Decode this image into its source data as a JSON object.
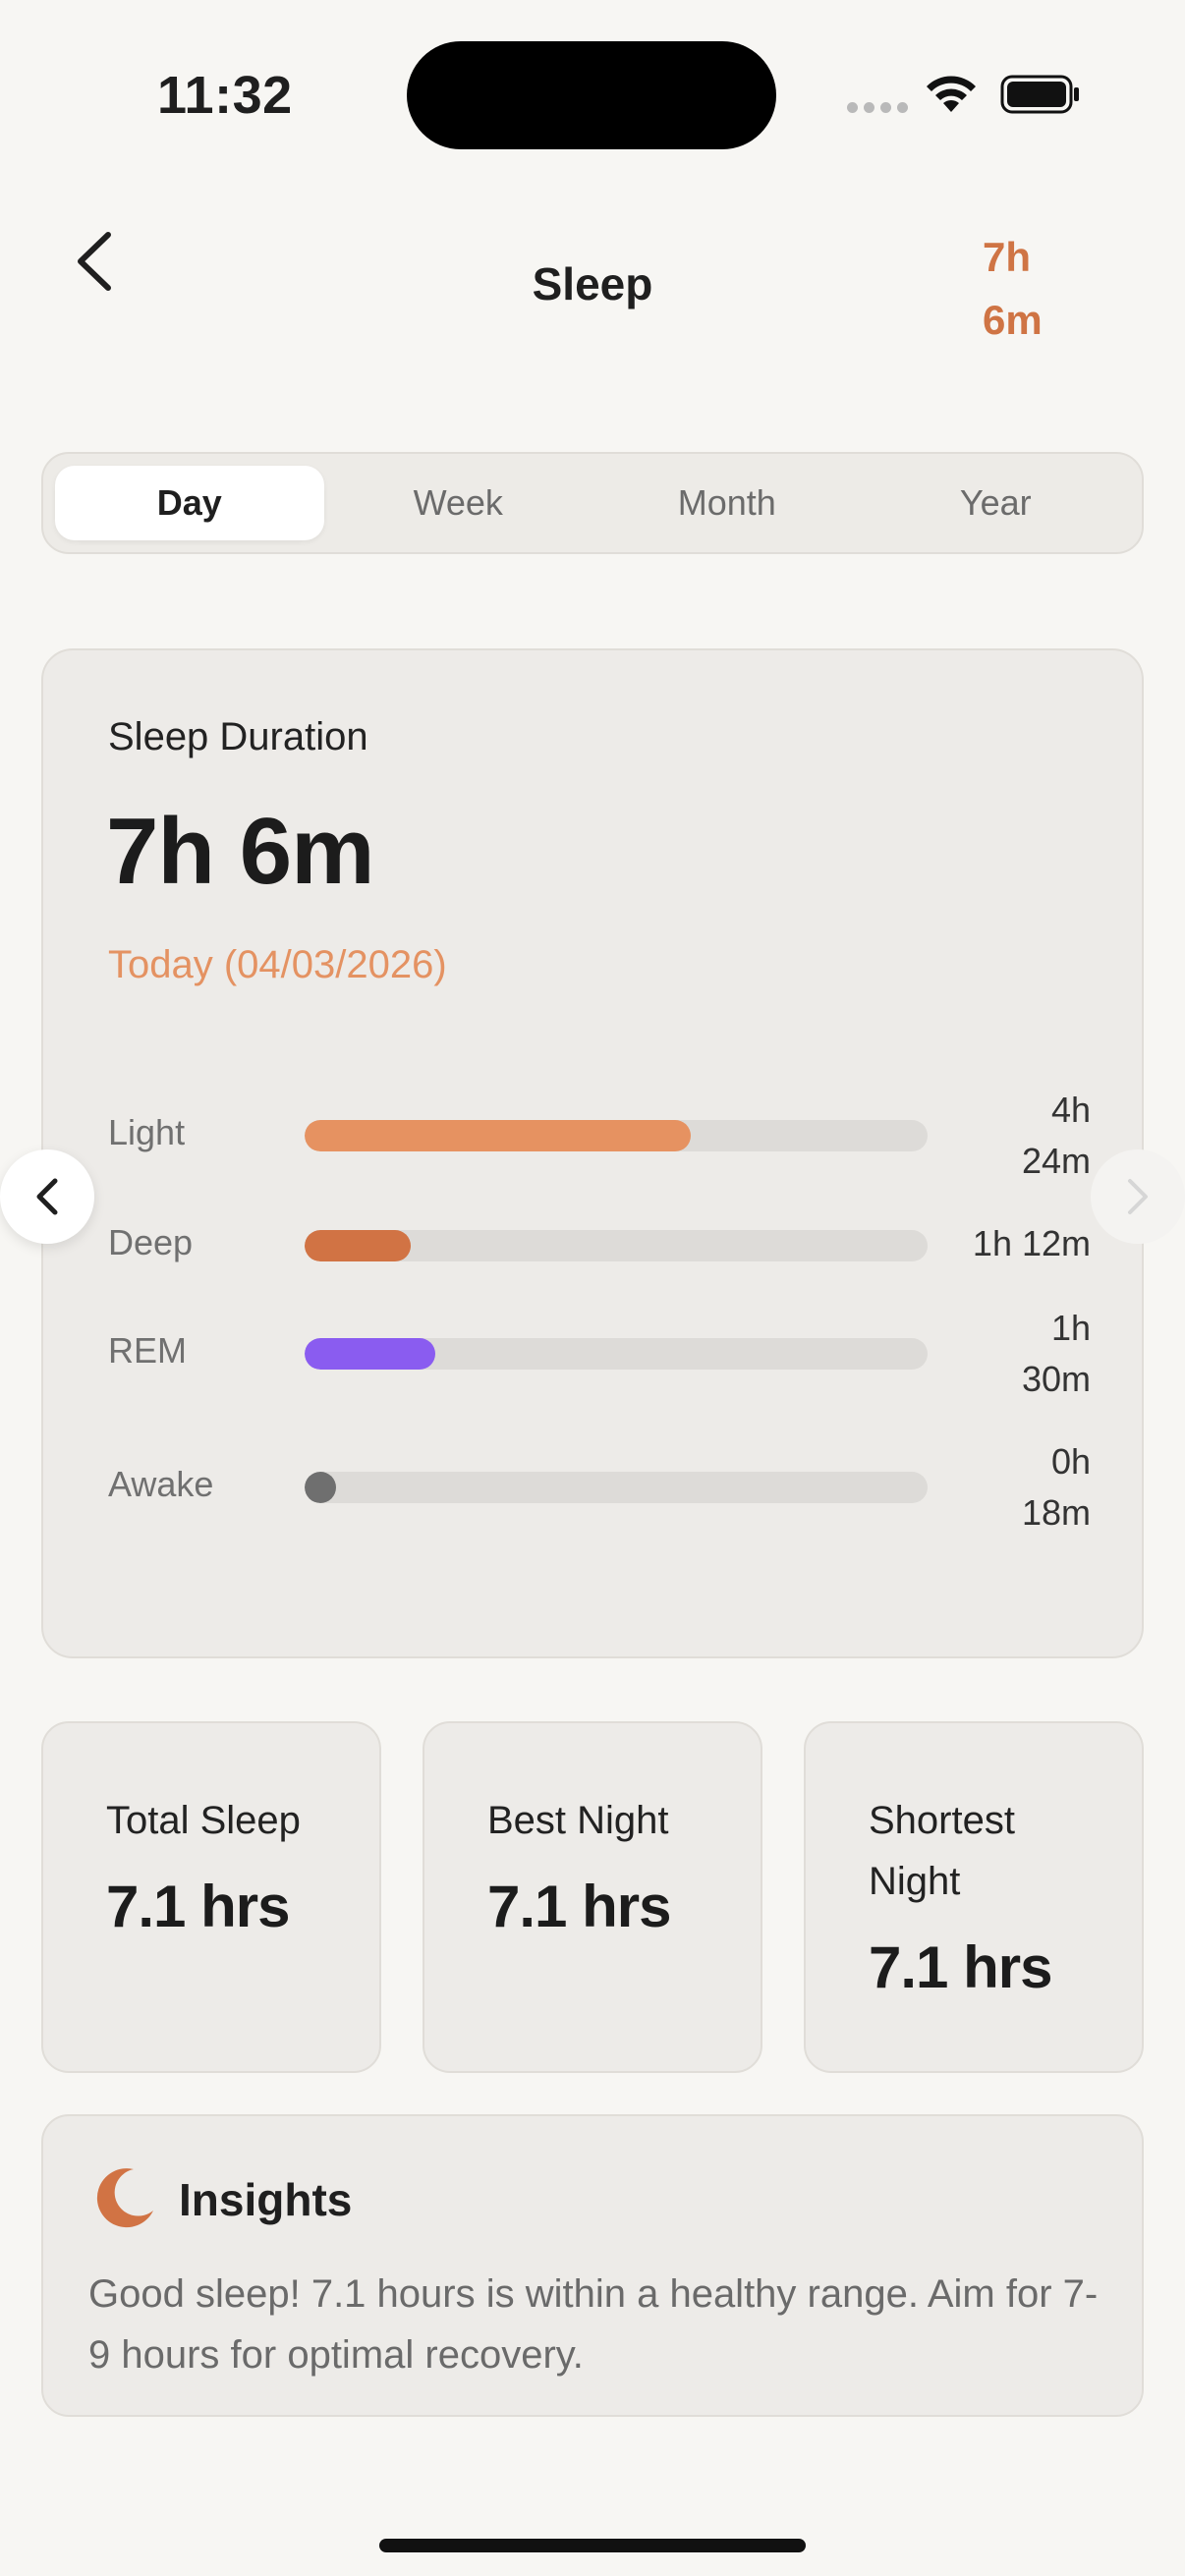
{
  "status_bar": {
    "time": "11:32"
  },
  "header": {
    "title": "Sleep",
    "total_line1": "7h",
    "total_line2": "6m"
  },
  "tabs": [
    {
      "label": "Day",
      "active": true
    },
    {
      "label": "Week",
      "active": false
    },
    {
      "label": "Month",
      "active": false
    },
    {
      "label": "Year",
      "active": false
    }
  ],
  "summary": {
    "label": "Sleep Duration",
    "value": "7h 6m",
    "date": "Today (04/03/2026)"
  },
  "stages": [
    {
      "name": "Light",
      "time_line1": "4h",
      "time_line2": "24m",
      "fraction": 0.62,
      "color": "#e69261"
    },
    {
      "name": "Deep",
      "time_line1": "1h 12m",
      "time_line2": "",
      "fraction": 0.17,
      "color": "#d17344"
    },
    {
      "name": "REM",
      "time_line1": "1h",
      "time_line2": "30m",
      "fraction": 0.21,
      "color": "#8a5cf0"
    },
    {
      "name": "Awake",
      "time_line1": "0h",
      "time_line2": "18m",
      "fraction": 0.045,
      "color": "#6f6f6f"
    }
  ],
  "stats": [
    {
      "label": "Total Sleep",
      "value": "7.1 hrs"
    },
    {
      "label": "Best Night",
      "value": "7.1 hrs"
    },
    {
      "label": "Shortest Night",
      "value": "7.1 hrs"
    }
  ],
  "insights": {
    "title": "Insights",
    "text": "Good sleep! 7.1 hours is within a healthy range. Aim for 7-9 hours for optimal recovery.",
    "icon": "moon-icon",
    "icon_color": "#d17344"
  },
  "colors": {
    "accent": "#cf7444",
    "date": "#e49262"
  }
}
